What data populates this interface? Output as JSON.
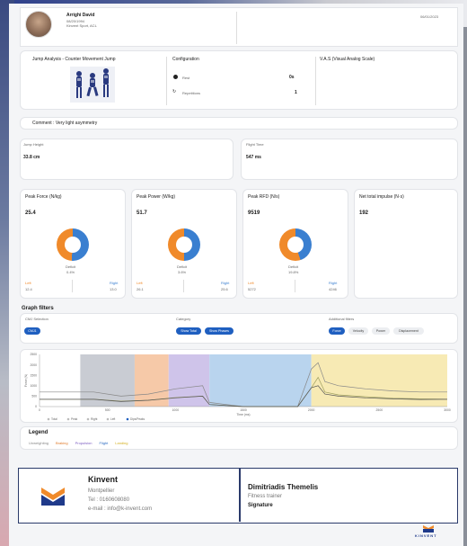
{
  "header": {
    "name": "Arrighi David",
    "dob": "08/20/1994",
    "club": "Kinvent Sport, ACL",
    "date": "06/01/2023"
  },
  "analysis": {
    "title": "Jump Analysis - Counter Movement Jump",
    "config_title": "Configuration",
    "config_rows": [
      {
        "label": "Rest",
        "value": "0s"
      },
      {
        "label": "Repetitions",
        "value": "1"
      }
    ],
    "vas_title": "V.A.S (Visual Analog Scale)"
  },
  "comment": "Comment : Very light asymmetry",
  "jump_height": {
    "label": "Jump Height",
    "value": "33.8 cm"
  },
  "flight_time": {
    "label": "Flight Time",
    "value": "547 ms"
  },
  "metrics": [
    {
      "title": "Peak Force (N/kg)",
      "value": "25.4",
      "deficit_label": "Deficit",
      "deficit": "0.4%",
      "left_label": "Left",
      "left": "12.4",
      "right_label": "Right",
      "right": "13.0",
      "left_pct": 0.49
    },
    {
      "title": "Peak Power (W/kg)",
      "value": "51.7",
      "deficit_label": "Deficit",
      "deficit": "3.6%",
      "left_label": "Left",
      "left": "26.1",
      "right_label": "Right",
      "right": "25.6",
      "left_pct": 0.5
    },
    {
      "title": "Peak RFD (N/s)",
      "value": "9519",
      "deficit_label": "Deficit",
      "deficit": "19.8%",
      "left_label": "Left",
      "left": "5272",
      "right_label": "Right",
      "right": "4246",
      "left_pct": 0.55
    },
    {
      "title": "Net total impulse (N·s)",
      "value": "192"
    }
  ],
  "filters": {
    "title": "Graph filters",
    "cmj_label": "CMJ Selection",
    "cmj_pill": "CMJ1",
    "category_label": "Category",
    "category_pills": [
      "Show Total",
      "Show Phases"
    ],
    "additional_label": "Additional filters",
    "additional_pills": [
      "Force",
      "Velocity",
      "Power",
      "Displacement"
    ]
  },
  "chart_data": {
    "type": "line",
    "ylabel": "Force (N)",
    "xlabel": "Time (ms)",
    "x_ticks": [
      "0",
      "500",
      "1000",
      "1500",
      "2000",
      "2500",
      "3000"
    ],
    "y_ticks": [
      "2500",
      "2000",
      "1500",
      "1000",
      "500",
      "0"
    ],
    "xlim": [
      0,
      3000
    ],
    "ylim": [
      0,
      2500
    ],
    "phases": [
      {
        "name": "Unweighting",
        "start": 300,
        "end": 700,
        "color": "#c9ccd3"
      },
      {
        "name": "Braking",
        "start": 700,
        "end": 950,
        "color": "#f6c9a8"
      },
      {
        "name": "Propulsion",
        "start": 950,
        "end": 1250,
        "color": "#cfc4ea"
      },
      {
        "name": "Flight",
        "start": 1250,
        "end": 2000,
        "color": "#b9d4ee"
      },
      {
        "name": "Landing",
        "start": 2000,
        "end": 3000,
        "color": "#f7eab4"
      }
    ],
    "series": [
      {
        "name": "Total",
        "color": "#888888",
        "x": [
          0,
          400,
          600,
          800,
          1000,
          1200,
          1250,
          1500,
          1900,
          2000,
          2050,
          2100,
          2200,
          2400,
          2600,
          2800,
          3000
        ],
        "y": [
          700,
          700,
          500,
          600,
          850,
          1000,
          200,
          0,
          0,
          1800,
          2100,
          1200,
          1000,
          850,
          750,
          700,
          700
        ]
      },
      {
        "name": "Left",
        "color": "#a0a060",
        "x": [
          0,
          400,
          600,
          800,
          1000,
          1200,
          1250,
          1500,
          1900,
          2000,
          2050,
          2100,
          2200,
          2400,
          2600,
          2800,
          3000
        ],
        "y": [
          350,
          350,
          260,
          300,
          430,
          500,
          100,
          0,
          0,
          900,
          1400,
          700,
          560,
          470,
          400,
          370,
          350
        ]
      },
      {
        "name": "Right",
        "color": "#555555",
        "x": [
          0,
          400,
          600,
          800,
          1000,
          1200,
          1250,
          1500,
          1900,
          2000,
          2050,
          2100,
          2200,
          2400,
          2600,
          2800,
          3000
        ],
        "y": [
          350,
          350,
          240,
          300,
          420,
          500,
          100,
          0,
          0,
          900,
          1000,
          600,
          500,
          420,
          370,
          340,
          350
        ]
      }
    ],
    "legend_items": [
      "Total",
      "Peak",
      "Right",
      "Left",
      "Dips/Peaks"
    ]
  },
  "legend": {
    "title": "Legend",
    "items": [
      {
        "label": "Unweighting",
        "color": "#888888"
      },
      {
        "label": "Braking",
        "color": "#e07a2a"
      },
      {
        "label": "Propulsion",
        "color": "#7a5ac0"
      },
      {
        "label": "Flight",
        "color": "#2a6ac0"
      },
      {
        "label": "Landing",
        "color": "#d4b020"
      }
    ]
  },
  "footer": {
    "company": "Kinvent",
    "city": "Montpellier",
    "tel": "Tel : 0160608080",
    "email": "e-mail : info@k-invent.com",
    "trainer_name": "Dimitriadis Themelis",
    "trainer_role": "Fitness trainer",
    "signature": "Signature",
    "brand": "KINVENT"
  },
  "colors": {
    "left": "#f08a2a",
    "right": "#3a7fd0",
    "accent": "#1f5fc0"
  }
}
